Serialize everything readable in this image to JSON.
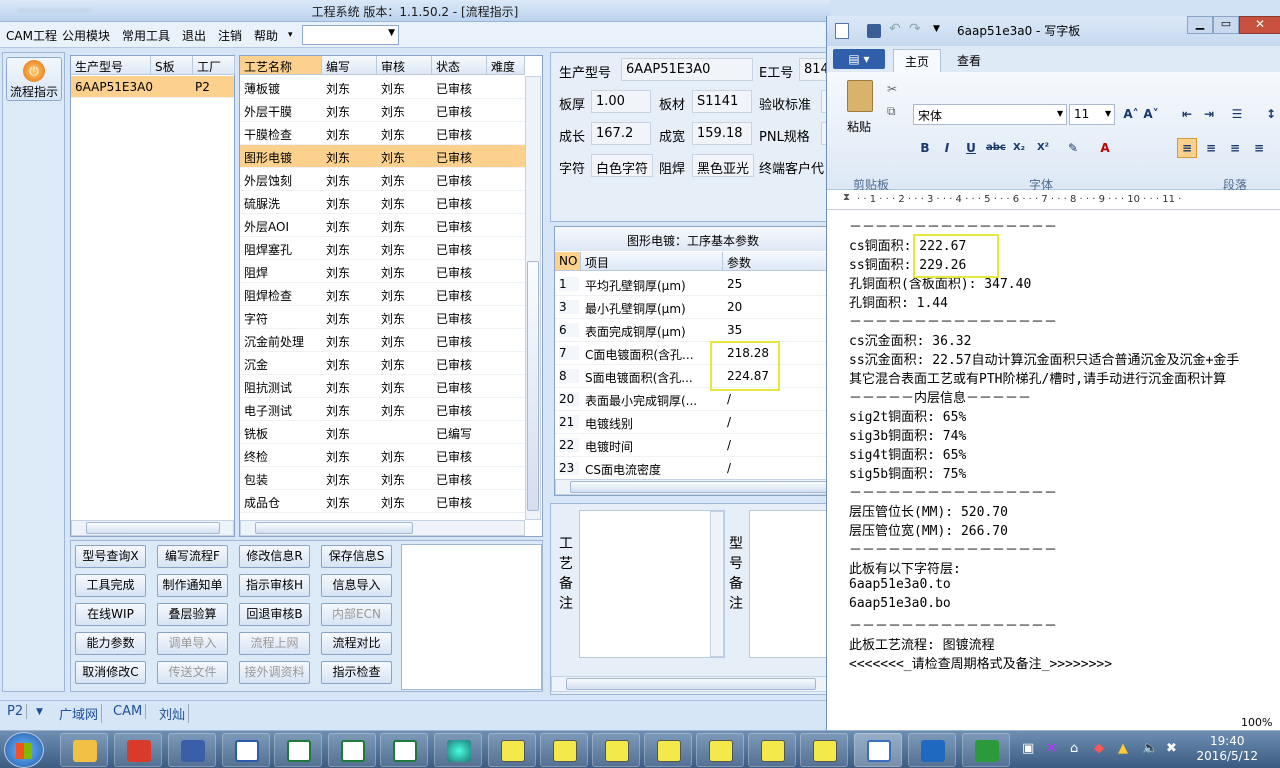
{
  "main_window": {
    "title": "工程系统   版本：1.1.50.2 - [流程指示]",
    "menu": [
      "CAM工程",
      "公用模块",
      "常用工具",
      "退出",
      "注销",
      "帮助"
    ],
    "help_arrow": "▾",
    "left_nav_button": "流程指示",
    "product_list": {
      "headers": [
        "生产型号",
        "S板",
        "工厂"
      ],
      "rows": [
        [
          "6AAP51E3A0",
          "",
          "P2"
        ]
      ]
    },
    "process_table": {
      "headers": [
        "工艺名称",
        "编写",
        "审核",
        "状态",
        "难度"
      ],
      "selected_index": 3,
      "rows": [
        [
          "薄板镀",
          "刘东",
          "刘东",
          "已审核"
        ],
        [
          "外层干膜",
          "刘东",
          "刘东",
          "已审核"
        ],
        [
          "干膜检查",
          "刘东",
          "刘东",
          "已审核"
        ],
        [
          "图形电镀",
          "刘东",
          "刘东",
          "已审核"
        ],
        [
          "外层蚀刻",
          "刘东",
          "刘东",
          "已审核"
        ],
        [
          "硫脲洗",
          "刘东",
          "刘东",
          "已审核"
        ],
        [
          "外层AOI",
          "刘东",
          "刘东",
          "已审核"
        ],
        [
          "阻焊塞孔",
          "刘东",
          "刘东",
          "已审核"
        ],
        [
          "阻焊",
          "刘东",
          "刘东",
          "已审核"
        ],
        [
          "阻焊检查",
          "刘东",
          "刘东",
          "已审核"
        ],
        [
          "字符",
          "刘东",
          "刘东",
          "已审核"
        ],
        [
          "沉金前处理",
          "刘东",
          "刘东",
          "已审核"
        ],
        [
          "沉金",
          "刘东",
          "刘东",
          "已审核"
        ],
        [
          "阻抗测试",
          "刘东",
          "刘东",
          "已审核"
        ],
        [
          "电子测试",
          "刘东",
          "刘东",
          "已审核"
        ],
        [
          "铣板",
          "刘东",
          "",
          "已编写"
        ],
        [
          "终检",
          "刘东",
          "刘东",
          "已审核"
        ],
        [
          "包装",
          "刘东",
          "刘东",
          "已审核"
        ],
        [
          "成品仓",
          "刘东",
          "刘东",
          "已审核"
        ]
      ]
    },
    "info": {
      "product_label": "生产型号",
      "product_value": "6AAP51E3A0",
      "e_label": "E工号",
      "e_value": "814",
      "thickness_label": "板厚",
      "thickness_value": "1.00",
      "material_label": "板材",
      "material_value": "S1141",
      "standard_label": "验收标准",
      "finish_len_label": "成长",
      "finish_len_value": "167.2",
      "finish_wid_label": "成宽",
      "finish_wid_value": "159.18",
      "pnl_label": "PNL规格",
      "char_label": "字符",
      "char_value": "白色字符",
      "mask_label": "阻焊",
      "mask_value": "黑色亚光",
      "customer_label": "终端客户代"
    },
    "params": {
      "title": "图形电镀：工序基本参数",
      "headers": [
        "NO",
        "项目",
        "参数"
      ],
      "rows": [
        [
          "1",
          "平均孔壁铜厚(μm)",
          "25"
        ],
        [
          "3",
          "最小孔壁铜厚(μm)",
          "20"
        ],
        [
          "6",
          "表面完成铜厚(μm)",
          "35"
        ],
        [
          "7",
          "C面电镀面积(含孔...",
          "218.28"
        ],
        [
          "8",
          "S面电镀面积(含孔...",
          "224.87"
        ],
        [
          "20",
          "表面最小完成铜厚(...",
          "/"
        ],
        [
          "21",
          "电镀线别",
          "/"
        ],
        [
          "22",
          "电镀时间",
          "/"
        ],
        [
          "23",
          "CS面电流密度",
          "/"
        ]
      ]
    },
    "notes": {
      "process_note_label": "工艺备注",
      "model_note_label": "型号备注"
    },
    "buttons": [
      [
        "型号查询X",
        "编写流程F",
        "修改信息R",
        "保存信息S"
      ],
      [
        "工具完成",
        "制作通知单",
        "指示审核H",
        "信息导入"
      ],
      [
        "在线WIP",
        "叠层验算",
        "回退审核B",
        "内部ECN"
      ],
      [
        "能力参数",
        "调单导入",
        "流程上网",
        "流程对比"
      ],
      [
        "取消修改C",
        "传送文件",
        "接外调资料",
        "指示检查"
      ]
    ],
    "disabled_buttons": [
      "内部ECN",
      "调单导入",
      "流程上网",
      "传送文件",
      "接外调资料"
    ],
    "status_bar": [
      "P2",
      "广域网",
      "CAM",
      "刘灿"
    ]
  },
  "wordpad": {
    "title": "6aap51e3a0 - 写字板",
    "tabs": [
      "主页",
      "查看"
    ],
    "font_name": "宋体",
    "font_size": "11",
    "clipboard_label": "粘贴",
    "group_labels": [
      "剪贴板",
      "字体",
      "段落"
    ],
    "ruler": "· · 1 · · · 2 · · · 3 · · · 4 · · · 5 · · · 6 · · · 7 · · · 8 · · · 9 · · · 10 · · · 11 ·",
    "zoom": "100%",
    "lines": [
      "－－－－－－－－－－－－－－－－",
      "cs铜面积: 222.67",
      "ss铜面积: 229.26",
      "孔铜面积(含板面积): 347.40",
      "孔铜面积: 1.44",
      "－－－－－－－－－－－－－－－－",
      "cs沉金面积: 36.32",
      "ss沉金面积: 22.57自动计算沉金面积只适合普通沉金及沉金+金手",
      "其它混合表面工艺或有PTH阶梯孔/槽时,请手动进行沉金面积计算",
      "－－－－－内层信息－－－－－",
      "sig2t铜面积: 65%",
      "sig3b铜面积: 74%",
      "sig4t铜面积: 65%",
      "sig5b铜面积: 75%",
      "－－－－－－－－－－－－－－－－",
      "层压管位长(MM): 520.70",
      "层压管位宽(MM): 266.70",
      "－－－－－－－－－－－－－－－－",
      "此板有以下字符层:",
      "6aap51e3a0.to",
      "6aap51e3a0.bo",
      "－－－－－－－－－－－－－－－－",
      "此板工艺流程: 图镀流程",
      "<<<<<<<_请检查周期格式及备注_>>>>>>>>"
    ]
  },
  "taskbar": {
    "time": "19:40",
    "date": "2016/5/12"
  },
  "colors": {
    "selected_row": "#fbd18d",
    "highlight_box": "#e8e83c"
  }
}
